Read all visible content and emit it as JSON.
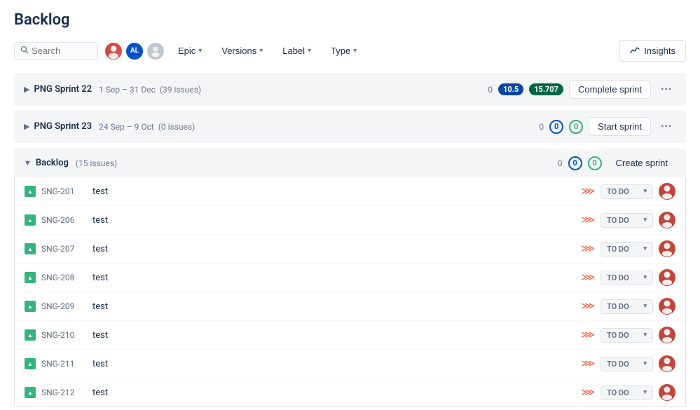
{
  "page": {
    "title": "Backlog"
  },
  "toolbar": {
    "search_placeholder": "Search",
    "epic_label": "Epic",
    "versions_label": "Versions",
    "label_label": "Label",
    "type_label": "Type",
    "insights_label": "Insights"
  },
  "sprints": [
    {
      "id": "sprint22",
      "name": "PNG Sprint 22",
      "dates": "1 Sep – 31 Dec",
      "issue_count": "39 issues",
      "zero_count": "0",
      "badge1": "10.5",
      "badge2": "15.707",
      "action_label": "Complete sprint",
      "expanded": false
    },
    {
      "id": "sprint23",
      "name": "PNG Sprint 23",
      "dates": "24 Sep – 9 Oct",
      "issue_count": "0 issues",
      "zero_count": "0",
      "action_label": "Start sprint",
      "expanded": false
    }
  ],
  "backlog": {
    "label": "Backlog",
    "issue_count": "(15 issues)",
    "zero_count": "0",
    "create_sprint_label": "Create sprint",
    "issues": [
      {
        "id": "SNG-201",
        "name": "test",
        "status": "TO DO"
      },
      {
        "id": "SNG-206",
        "name": "test",
        "status": "TO DO"
      },
      {
        "id": "SNG-207",
        "name": "test",
        "status": "TO DO"
      },
      {
        "id": "SNG-208",
        "name": "test",
        "status": "TO DO"
      },
      {
        "id": "SNG-209",
        "name": "test",
        "status": "TO DO"
      },
      {
        "id": "SNG-210",
        "name": "test",
        "status": "TO DO"
      },
      {
        "id": "SNG-211",
        "name": "test",
        "status": "TO DO"
      },
      {
        "id": "SNG-212",
        "name": "test",
        "status": "TO DO"
      }
    ]
  },
  "colors": {
    "accent_blue": "#0052cc",
    "accent_green": "#36b37e",
    "priority_red": "#ff5630"
  }
}
